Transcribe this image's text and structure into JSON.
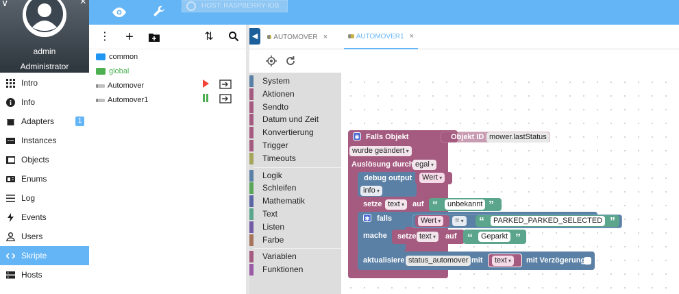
{
  "topbar": {
    "host_label": "HOST: RASPBERRY-IOB",
    "icons": [
      "eye-icon",
      "wrench-icon"
    ]
  },
  "user": {
    "name": "admin",
    "role": "Administrator"
  },
  "menu": {
    "items": [
      {
        "label": "Intro",
        "icon": "grid-icon"
      },
      {
        "label": "Info",
        "icon": "info-icon"
      },
      {
        "label": "Adapters",
        "icon": "store-icon",
        "badge": "1"
      },
      {
        "label": "Instances",
        "icon": "instances-icon"
      },
      {
        "label": "Objects",
        "icon": "objects-icon"
      },
      {
        "label": "Enums",
        "icon": "enums-icon"
      },
      {
        "label": "Log",
        "icon": "list-icon"
      },
      {
        "label": "Events",
        "icon": "bolt-icon"
      },
      {
        "label": "Users",
        "icon": "person-icon"
      },
      {
        "label": "Skripte",
        "icon": "code-icon",
        "active": true
      },
      {
        "label": "Hosts",
        "icon": "server-icon"
      }
    ]
  },
  "tree": {
    "folders": [
      {
        "label": "common",
        "color": "#2196f3"
      },
      {
        "label": "global",
        "color": "#4caf50"
      }
    ],
    "scripts": [
      {
        "label": "Automover",
        "state": "stopped"
      },
      {
        "label": "Automover1",
        "state": "running"
      }
    ]
  },
  "tabs": [
    {
      "label": "AUTOMOVER",
      "active": false
    },
    {
      "label": "AUTOMOVER1",
      "active": true
    }
  ],
  "toolbox": {
    "groups": [
      [
        {
          "label": "System",
          "color": "#5b80a5"
        },
        {
          "label": "Aktionen",
          "color": "#a55b80"
        },
        {
          "label": "Sendto",
          "color": "#a55b80"
        },
        {
          "label": "Datum und Zeit",
          "color": "#a55b80"
        },
        {
          "label": "Konvertierung",
          "color": "#a55b80"
        },
        {
          "label": "Trigger",
          "color": "#a55b80"
        },
        {
          "label": "Timeouts",
          "color": "#a5a55b"
        }
      ],
      [
        {
          "label": "Logik",
          "color": "#5b80a5"
        },
        {
          "label": "Schleifen",
          "color": "#5ba55b"
        },
        {
          "label": "Mathematik",
          "color": "#5b67a5"
        },
        {
          "label": "Text",
          "color": "#5ba58c"
        },
        {
          "label": "Listen",
          "color": "#745ba5"
        },
        {
          "label": "Farbe",
          "color": "#a5745b"
        }
      ],
      [
        {
          "label": "Variablen",
          "color": "#a55b80"
        },
        {
          "label": "Funktionen",
          "color": "#995ba5"
        }
      ]
    ]
  },
  "blocks": {
    "trigger": {
      "title": "Falls Objekt",
      "object_id_label": "Objekt ID",
      "object_id": "mower.lastStatus",
      "condition": "wurde geändert",
      "triggered_by_label": "Auslösung durch",
      "triggered_by": "egal"
    },
    "debug": {
      "label": "debug output",
      "value": "Wert",
      "level": "info"
    },
    "set1": {
      "label": "setze",
      "var": "text",
      "to": "auf",
      "value": "unbekannt"
    },
    "if": {
      "label": "falls",
      "left": "Wert",
      "op": "=",
      "right": "PARKED_PARKED_SELECTED",
      "do_label": "mache",
      "set_label": "setze",
      "set_var": "text",
      "set_to": "auf",
      "set_value": "Geparkt"
    },
    "update": {
      "label": "aktualisiere",
      "target": "status_automover",
      "with_label": "mit",
      "value": "text",
      "delay_label": "mit Verzögerung"
    }
  },
  "colors": {
    "accent": "#64b5f6",
    "event_block": "#a55b80",
    "logic_block": "#5b80a5",
    "text_block": "#5ba58c"
  }
}
